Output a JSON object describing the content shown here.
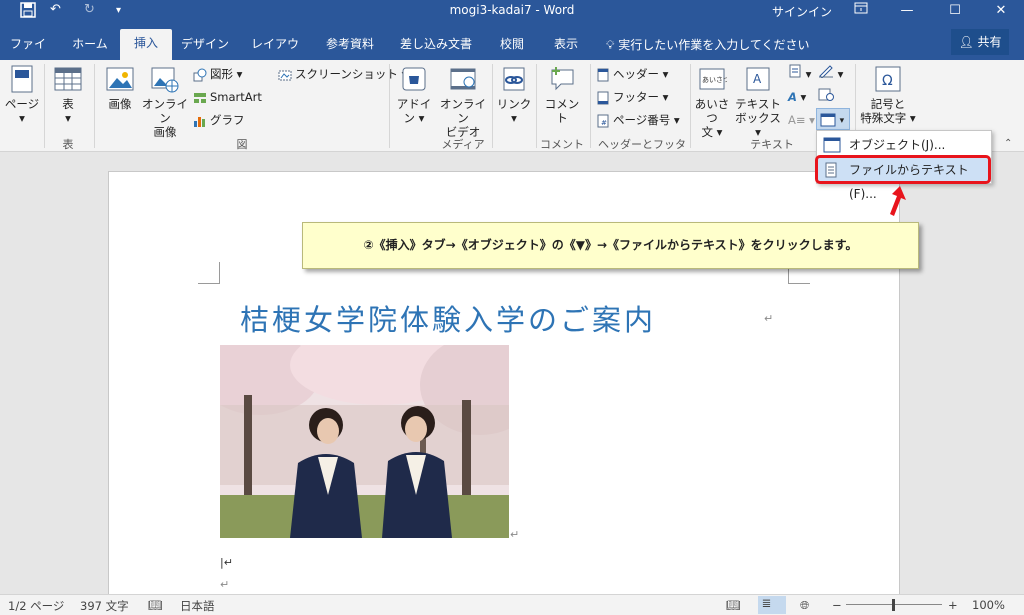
{
  "titlebar": {
    "title": "mogi3-kadai7  -  Word",
    "signin": "サインイン",
    "undo_icon": "undo-icon",
    "redo_icon": "redo-icon"
  },
  "tabs": [
    {
      "label": "ファイル"
    },
    {
      "label": "ホーム"
    },
    {
      "label": "挿入"
    },
    {
      "label": "デザイン"
    },
    {
      "label": "レイアウト"
    },
    {
      "label": "参考資料"
    },
    {
      "label": "差し込み文書"
    },
    {
      "label": "校閲"
    },
    {
      "label": "表示"
    }
  ],
  "tellme": "実行したい作業を入力してください",
  "share": "共有",
  "ribbon": {
    "page": "ページ",
    "table": "表",
    "picture": "画像",
    "online_picture_1": "オンライン",
    "online_picture_2": "画像",
    "shapes": "図形",
    "smartart": "SmartArt",
    "chart": "グラフ",
    "screenshot": "スクリーンショット",
    "addin_1": "アドイ",
    "addin_2": "ン",
    "online_video_1": "オンライン",
    "online_video_2": "ビデオ",
    "link": "リンク",
    "comment": "コメント",
    "header": "ヘッダー",
    "footer": "フッター",
    "page_number": "ページ番号",
    "greeting_1": "あいさつ",
    "greeting_2": "文",
    "textbox_1": "テキスト",
    "textbox_2": "ボックス",
    "symbol_1": "記号と",
    "symbol_2": "特殊文字",
    "groups": {
      "table": "表",
      "illustrations": "図",
      "media": "メディア",
      "comment": "コメント",
      "header_footer": "ヘッダーとフッター",
      "text": "テキスト"
    }
  },
  "dropdown": {
    "items": [
      {
        "label": "オブジェクト(J)..."
      },
      {
        "label": "ファイルからテキスト(F)..."
      }
    ]
  },
  "callout": "②《挿入》タブ→《オブジェクト》の《▼》→《ファイルからテキスト》をクリックします。",
  "document": {
    "title": "桔梗女学院体験入学のご案内"
  },
  "status": {
    "page": "1/2 ページ",
    "words": "397 文字",
    "language": "日本語",
    "zoom": "100%"
  },
  "colors": {
    "word_blue": "#2b579a",
    "title_blue": "#2e74b5",
    "highlight_red": "#e8141c",
    "callout_bg": "#ffffcc"
  }
}
